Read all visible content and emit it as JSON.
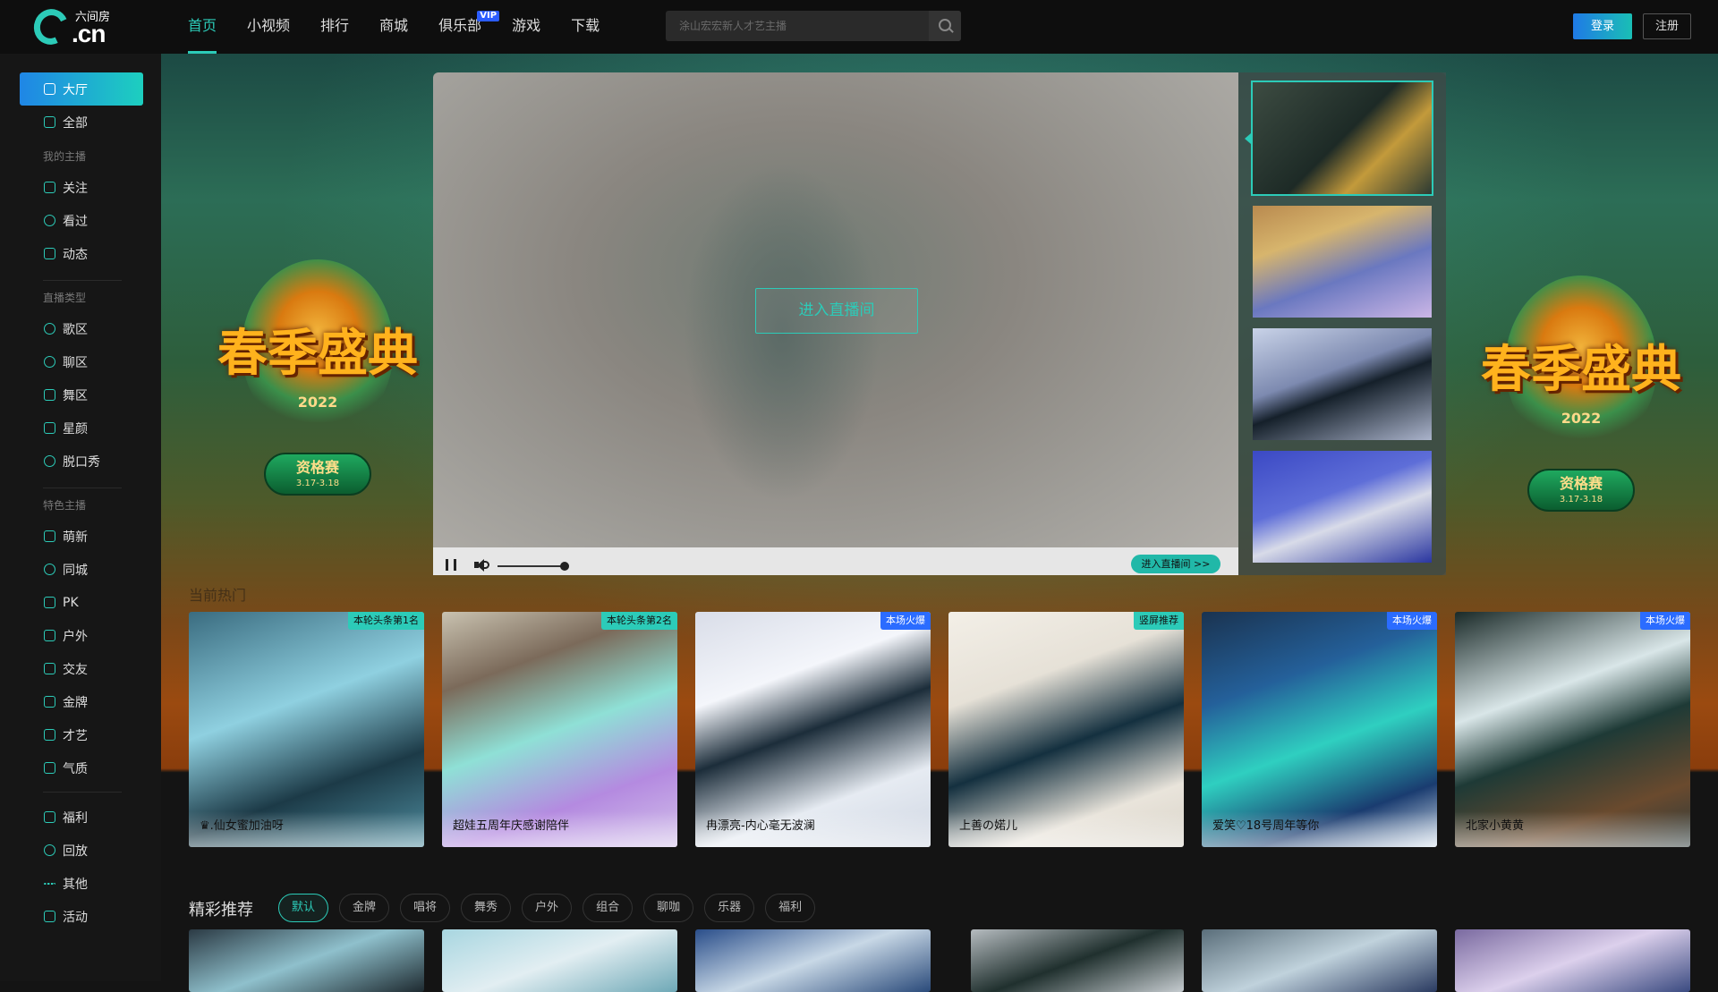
{
  "header": {
    "logo_text": ".cn",
    "logo_name": "六间房",
    "nav": [
      "首页",
      "小视频",
      "排行",
      "商城",
      "俱乐部",
      "游戏",
      "下载"
    ],
    "vip_badge": "VIP",
    "search_placeholder": "涂山宏宏新人才艺主播",
    "login": "登录",
    "register": "注册"
  },
  "sidebar": {
    "hall": "大厅",
    "all": "全部",
    "my_anchor": "我的主播",
    "follow": "关注",
    "viewed": "看过",
    "moments": "动态",
    "live_type": "直播类型",
    "singing": "歌区",
    "chat": "聊区",
    "dance": "舞区",
    "beauty": "星颜",
    "talkshow": "脱口秀",
    "featured": "特色主播",
    "newbie": "萌新",
    "local": "同城",
    "pk": "PK",
    "outdoor": "户外",
    "social": "交友",
    "gold": "金牌",
    "talent": "才艺",
    "vibe": "气质",
    "welfare": "福利",
    "replay": "回放",
    "other": "其他",
    "activity": "活动"
  },
  "banner": {
    "title": "春季盛典",
    "year": "2022",
    "stage": "资格赛",
    "dates": "3.17-3.18"
  },
  "player": {
    "enter_center": "进入直播间",
    "enter_small": "进入直播间 >>",
    "volume": 0.85
  },
  "hot": {
    "title": "当前热门",
    "cards": [
      {
        "tag": "本轮头条第1名",
        "name": "♛.仙女蜜加油呀",
        "tag_color": "#2ccbb8"
      },
      {
        "tag": "本轮头条第2名",
        "name": "超娃五周年庆感谢陪伴",
        "tag_color": "#2ccbb8"
      },
      {
        "tag": "本场火爆",
        "name": "冉漂亮-内心毫无波澜",
        "tag_color": "#2b6cff"
      },
      {
        "tag": "竖屏推荐",
        "name": "上善の婼儿",
        "tag_color": "#2ccbb8"
      },
      {
        "tag": "本场火爆",
        "name": "爱笑♡18号周年等你",
        "tag_color": "#2b6cff"
      },
      {
        "tag": "本场火爆",
        "name": "北家小黄黄",
        "tag_color": "#2b6cff"
      }
    ]
  },
  "recommend": {
    "title": "精彩推荐",
    "tabs": [
      "默认",
      "金牌",
      "唱将",
      "舞秀",
      "户外",
      "组合",
      "聊咖",
      "乐器",
      "福利"
    ]
  }
}
